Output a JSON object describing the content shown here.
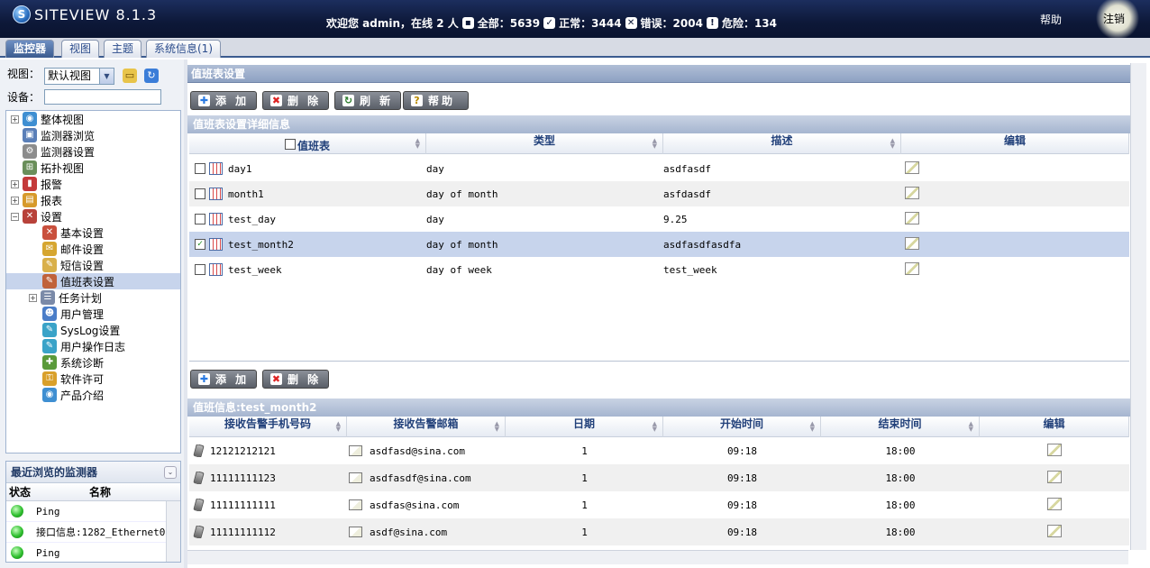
{
  "app": {
    "logo_letter": "S",
    "title": "SITEVIEW 8.1.3"
  },
  "header": {
    "welcome": "欢迎您 admin，在线 2 人",
    "total": "全部：5639",
    "normal": "正常：3444",
    "error": "错误：2004",
    "danger": "危险：134",
    "help": "帮助",
    "logout": "注销"
  },
  "tabs": [
    "监控器",
    "视图",
    "主题",
    "系统信息(1)"
  ],
  "sidebar": {
    "view_label": "视图：",
    "view_value": "默认视图",
    "device_label": "设备：",
    "tree": [
      {
        "label": "整体视图",
        "expand": "+"
      },
      {
        "label": "监测器浏览",
        "expand": ""
      },
      {
        "label": "监测器设置",
        "expand": ""
      },
      {
        "label": "拓扑视图",
        "expand": ""
      },
      {
        "label": "报警",
        "expand": "+"
      },
      {
        "label": "报表",
        "expand": "+"
      },
      {
        "label": "设置",
        "expand": "−"
      },
      {
        "label": "基本设置",
        "expand": ""
      },
      {
        "label": "邮件设置",
        "expand": ""
      },
      {
        "label": "短信设置",
        "expand": ""
      },
      {
        "label": "值班表设置",
        "expand": ""
      },
      {
        "label": "任务计划",
        "expand": "+"
      },
      {
        "label": "用户管理",
        "expand": ""
      },
      {
        "label": "SysLog设置",
        "expand": ""
      },
      {
        "label": "用户操作日志",
        "expand": ""
      },
      {
        "label": "系统诊断",
        "expand": ""
      },
      {
        "label": "软件许可",
        "expand": ""
      },
      {
        "label": "产品介绍",
        "expand": ""
      }
    ],
    "recent": {
      "title": "最近浏览的监测器",
      "col_status": "状态",
      "col_name": "名称",
      "rows": [
        "Ping",
        "接口信息:1282_Ethernet0,",
        "Ping"
      ]
    }
  },
  "main": {
    "section_title": "值班表设置",
    "buttons": {
      "add": "添 加",
      "delete": "删 除",
      "refresh": "刷 新",
      "help": "帮助"
    },
    "detail_title": "值班表设置详细信息",
    "table1": {
      "headers": [
        "值班表",
        "类型",
        "描述",
        "编辑"
      ],
      "rows": [
        {
          "name": "day1",
          "type": "day",
          "desc": "asdfasdf",
          "checked": ""
        },
        {
          "name": "month1",
          "type": "day of month",
          "desc": "asfdasdf",
          "checked": ""
        },
        {
          "name": "test_day",
          "type": "day",
          "desc": "9.25",
          "checked": ""
        },
        {
          "name": "test_month2",
          "type": "day of month",
          "desc": "asdfasdfasdfa",
          "checked": "✓"
        },
        {
          "name": "test_week",
          "type": "day of week",
          "desc": "test_week",
          "checked": ""
        }
      ]
    },
    "info_title": "值班信息:test_month2",
    "table2": {
      "headers": [
        "接收告警手机号码",
        "接收告警邮箱",
        "日期",
        "开始时间",
        "结束时间",
        "编辑"
      ],
      "rows": [
        {
          "phone": "12121212121",
          "email": "asdfasd@sina.com",
          "date": "1",
          "start": "09:18",
          "end": "18:00"
        },
        {
          "phone": "11111111123",
          "email": "asdfasdf@sina.com",
          "date": "1",
          "start": "09:18",
          "end": "18:00"
        },
        {
          "phone": "11111111111",
          "email": "asdfas@sina.com",
          "date": "1",
          "start": "09:18",
          "end": "18:00"
        },
        {
          "phone": "11111111112",
          "email": "asdf@sina.com",
          "date": "1",
          "start": "09:18",
          "end": "18:00"
        }
      ]
    }
  }
}
